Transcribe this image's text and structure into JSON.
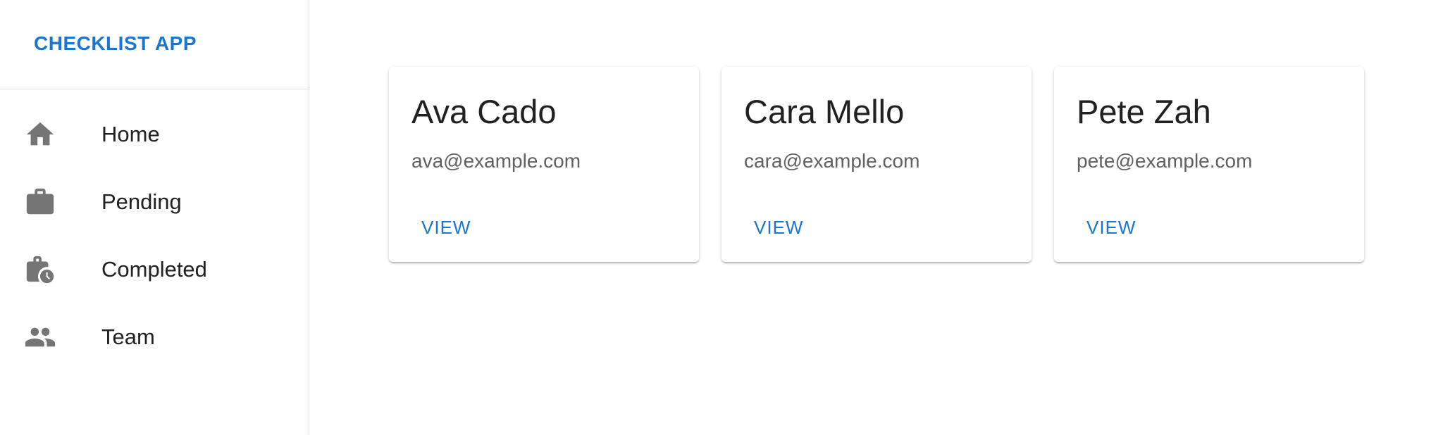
{
  "app": {
    "title": "CHECKLIST APP"
  },
  "sidebar": {
    "items": [
      {
        "label": "Home",
        "icon": "home-icon"
      },
      {
        "label": "Pending",
        "icon": "briefcase-icon"
      },
      {
        "label": "Completed",
        "icon": "briefcase-clock-icon"
      },
      {
        "label": "Team",
        "icon": "people-icon"
      }
    ]
  },
  "cards": [
    {
      "name": "Ava Cado",
      "email": "ava@example.com",
      "action": "VIEW"
    },
    {
      "name": "Cara Mello",
      "email": "cara@example.com",
      "action": "VIEW"
    },
    {
      "name": "Pete Zah",
      "email": "pete@example.com",
      "action": "VIEW"
    }
  ],
  "colors": {
    "accent": "#1976d2",
    "icon": "#757575",
    "divider": "#e0e0e0"
  }
}
